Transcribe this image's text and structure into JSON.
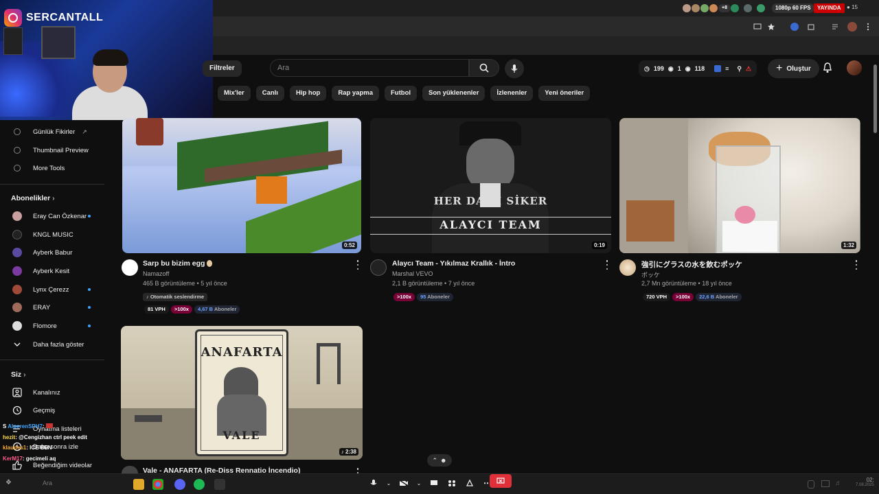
{
  "overlay": {
    "instagram_handle": "SERCANTALL"
  },
  "system_bar": {
    "stream_quality": "1080p 60 FPS",
    "live_label": "YAYINDA",
    "viewer_count": "15",
    "avatar_extra": "+8"
  },
  "header": {
    "filters_label": "Filtreler",
    "search_placeholder": "Ara",
    "stats": {
      "clock": "199",
      "eye": "1",
      "views": "118"
    },
    "create_label": "Oluştur"
  },
  "chips": [
    "Mix'ler",
    "Canlı",
    "Hip hop",
    "Rap yapma",
    "Futbol",
    "Son yüklenenler",
    "İzlenenler",
    "Yeni öneriler"
  ],
  "sidebar": {
    "tools": [
      {
        "label": "Günlük Fikirler",
        "icon": "extension-icon"
      },
      {
        "label": "Thumbnail Preview",
        "icon": "extension-icon"
      },
      {
        "label": "More Tools",
        "icon": "extension-icon"
      }
    ],
    "subs_heading": "Abonelikler",
    "subs": [
      {
        "label": "Eray Can Özkenar",
        "color": "#c9a0a0",
        "live": true
      },
      {
        "label": "KNGL MUSIC",
        "color": "#222222",
        "live": false
      },
      {
        "label": "Ayberk Babur",
        "color": "#5a4aa0",
        "live": false
      },
      {
        "label": "Ayberk Kesit",
        "color": "#7a3aa0",
        "live": false
      },
      {
        "label": "Lynx Çerezz",
        "color": "#a04a3a",
        "live": true
      },
      {
        "label": "ERAY",
        "color": "#a06a5a",
        "live": true
      },
      {
        "label": "Flomore",
        "color": "#dddddd",
        "live": true
      }
    ],
    "show_more": "Daha fazla göster",
    "you_heading": "Siz",
    "you_items": [
      {
        "label": "Kanalınız",
        "icon": "account-icon"
      },
      {
        "label": "Geçmiş",
        "icon": "history-icon"
      },
      {
        "label": "Oynatma listeleri",
        "icon": "playlist-icon"
      },
      {
        "label": "Daha sonra izle",
        "icon": "clock-icon"
      },
      {
        "label": "Beğendiğim videolar",
        "icon": "thumb-up-icon"
      }
    ]
  },
  "chat": [
    {
      "user": "S",
      "user2": "AlperenSPH7",
      "color": "#3ea6ff",
      "text": ": "
    },
    {
      "user": "hezit",
      "color": "#ffd84a",
      "text": ": @Cengizhan ctrl peek edit"
    },
    {
      "user": "klaudes1",
      "color": "#ffb02e",
      "text": ": ICE BEN"
    },
    {
      "user": "KerM17",
      "color": "#ff5a8a",
      "text": ": gecimeli aq"
    }
  ],
  "videos": [
    {
      "title": "Sarp bu bizim egg",
      "channel": "Namazoff",
      "meta": "465 B görüntüleme • 5 yıl önce",
      "duration": "0:52",
      "tag": "Otomatik seslendirme",
      "vph": "81 VPH",
      "pct": ">100x",
      "subs_num": "4,67 B",
      "subs_label": "Aboneler"
    },
    {
      "title": "Alaycı Team - Yıkılmaz Krallık - İntro",
      "channel": "Marshal VEVO",
      "meta": "2,1 B görüntüleme • 7 yıl önce",
      "duration": "0:19",
      "pct": ">100x",
      "subs_num": "95",
      "subs_label": "Aboneler",
      "thumb_text_1": "HER DAİM SİKER",
      "thumb_text_2": "ALAYCI TEAM"
    },
    {
      "title": "強引にグラスの水を飲むポッケ",
      "channel": "ポッケ",
      "meta": "2,7 Mn görüntüleme • 18 yıl önce",
      "duration": "1:32",
      "vph": "720 VPH",
      "pct": ">100x",
      "subs_num": "22,6 B",
      "subs_label": "Aboneler"
    },
    {
      "title": "Vale - ANAFARTA (Re-Diss Rennatio İncendio)",
      "duration": "2:38",
      "thumb_text_1": "ANAFARTA",
      "thumb_text_2": "VALE"
    }
  ],
  "taskbar": {
    "search_placeholder": "Ara",
    "clock": "02:",
    "date": "7.08.2025"
  }
}
